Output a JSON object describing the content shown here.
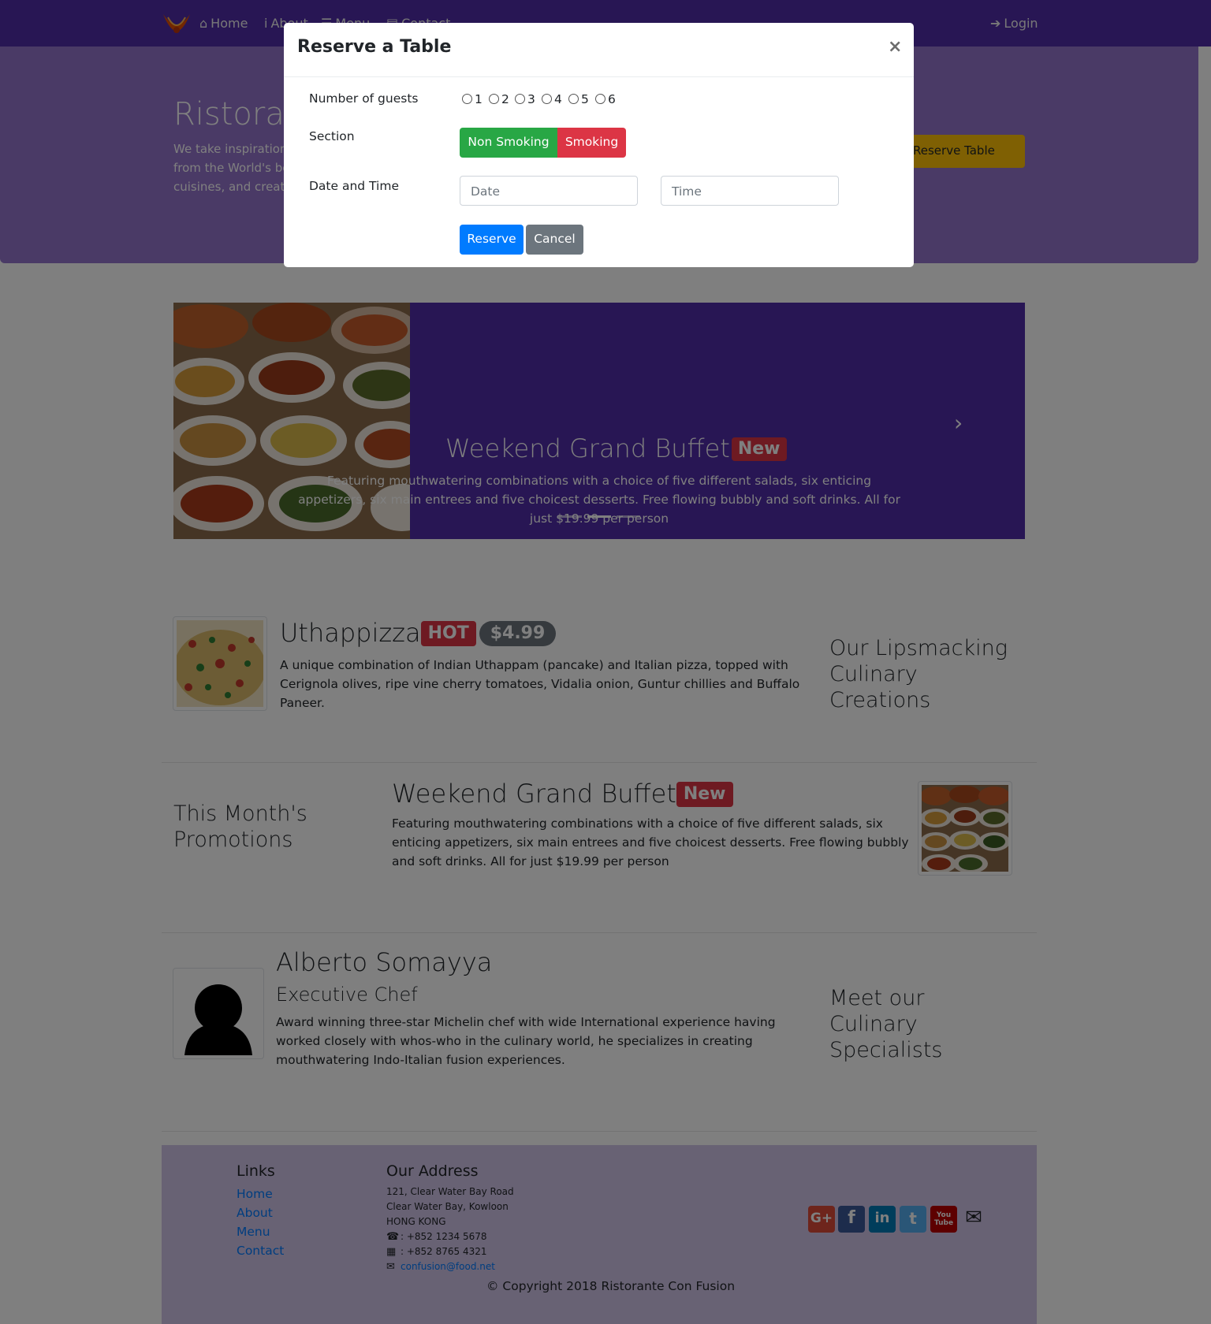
{
  "navbar": {
    "items": [
      {
        "icon": "home-icon",
        "label": "Home"
      },
      {
        "icon": "info-icon",
        "label": "About"
      },
      {
        "icon": "list-icon",
        "label": "Menu"
      },
      {
        "icon": "address-card-icon",
        "label": "Contact"
      }
    ],
    "login": {
      "icon": "sign-in-icon",
      "label": "Login"
    }
  },
  "jumbotron": {
    "title": "Ristorante con Fusion",
    "text": "We take inspiration from the World's best cuisines, and create a unique fusion experience. Our lipsmacking creations will tickle your culinary senses!",
    "button": "Reserve Table"
  },
  "carousel": {
    "title": "Weekend Grand Buffet",
    "badge": "New",
    "text": "Featuring mouthwatering combinations with a choice of five different salads, six enticing appetizers, six main entrees and five choicest desserts. Free flowing bubbly and soft drinks. All for just $19.99 per person",
    "active_slide": 2,
    "slide_count": 3
  },
  "dish": {
    "title": "Uthappizza",
    "badge_hot": "HOT",
    "price": "$4.99",
    "text": "A unique combination of Indian Uthappam (pancake) and Italian pizza, topped with Cerignola olives, ripe vine cherry tomatoes, Vidalia onion, Guntur chillies and Buffalo Paneer.",
    "side_heading": "Our Lipsmacking Culinary Creations"
  },
  "promotion": {
    "side_heading": "This Month's Promotions",
    "title": "Weekend Grand Buffet",
    "badge": "New",
    "text": "Featuring mouthwatering combinations with a choice of five different salads, six enticing appetizers, six main entrees and five choicest desserts. Free flowing bubbly and soft drinks. All for just $19.99 per person"
  },
  "leader": {
    "name": "Alberto Somayya",
    "designation": "Executive Chef",
    "text": "Award winning three-star Michelin chef with wide International experience having worked closely with whos-who in the culinary world, he specializes in creating mouthwatering Indo-Italian fusion experiences.",
    "side_heading": "Meet our Culinary Specialists"
  },
  "footer": {
    "links_title": "Links",
    "links": [
      "Home",
      "About",
      "Menu",
      "Contact"
    ],
    "address_title": "Our Address",
    "address_lines": [
      "121, Clear Water Bay Road",
      "Clear Water Bay, Kowloon",
      "HONG KONG"
    ],
    "phone": ": +852 1234 5678",
    "fax": ": +852 8765 4321",
    "email": "confusion@food.net",
    "social": [
      {
        "name": "google-plus-icon",
        "label": "G+",
        "color": "#DD4B39"
      },
      {
        "name": "facebook-icon",
        "label": "f",
        "color": "#3B5998"
      },
      {
        "name": "linkedin-icon",
        "label": "in",
        "color": "#007BB6"
      },
      {
        "name": "twitter-icon",
        "label": "t",
        "color": "#55ACEE"
      },
      {
        "name": "youtube-icon",
        "label": "You Tube",
        "color": "#BB0000"
      }
    ],
    "copyright": "© Copyright 2018 Ristorante Con Fusion"
  },
  "modal": {
    "title": "Reserve a Table",
    "close": "×",
    "guests_label": "Number of guests",
    "guest_options": [
      "1",
      "2",
      "3",
      "4",
      "5",
      "6"
    ],
    "section_label": "Section",
    "section_options": [
      "Non Smoking",
      "Smoking"
    ],
    "datetime_label": "Date and Time",
    "date_placeholder": "Date",
    "time_placeholder": "Time",
    "reserve_button": "Reserve",
    "cancel_button": "Cancel"
  },
  "colors": {
    "primary": "#512DA8",
    "light": "#9575CD",
    "footer": "#D1C4E9",
    "warning": "#FFC107",
    "danger": "#DC3545",
    "success": "#28A745",
    "button_primary": "#007BFF"
  }
}
